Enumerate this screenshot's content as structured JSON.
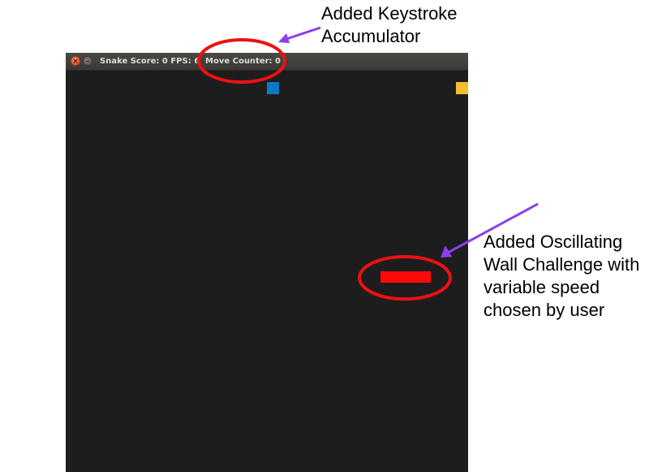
{
  "window": {
    "title_score": "Snake Score: 0 FPS: 6",
    "title_moves": "Move Counter: 0",
    "close_glyph": "×",
    "minimize_glyph": "–"
  },
  "game": {
    "background_color": "#1d1d1d",
    "snake_color": "#0a7ac4",
    "food_color": "#f5bd2f",
    "wall_color": "#ff0a0a"
  },
  "annotations": {
    "keystroke": {
      "line1": "Added Keystroke",
      "line2": "Accumulator"
    },
    "wall": {
      "line1": "Added Oscillating",
      "line2": "Wall Challenge with",
      "line3": "variable speed",
      "line4": "chosen by user"
    },
    "circle_color": "#ee1111",
    "arrow_color": "#8a3ff0"
  }
}
